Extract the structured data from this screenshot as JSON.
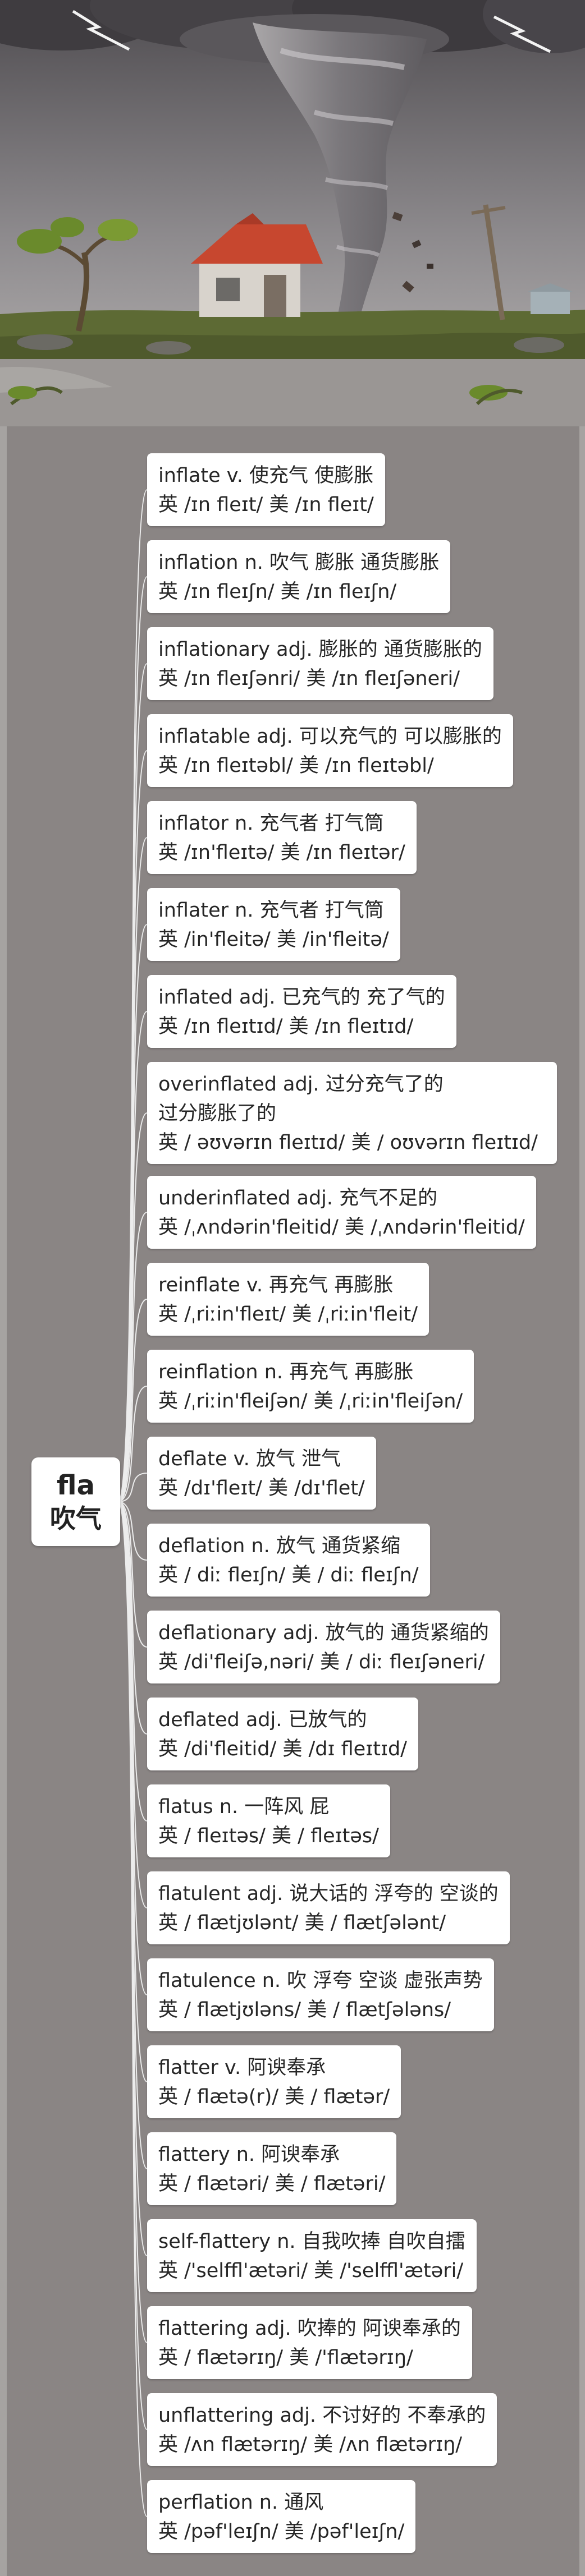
{
  "root": {
    "stem": "fla",
    "meaning": "吹气"
  },
  "words": [
    {
      "entry": "inflate v. 使充气 使膨胀",
      "pron": "英 /ɪn fleɪt/  美 /ɪn fleɪt/"
    },
    {
      "entry": "inflation n. 吹气 膨胀 通货膨胀",
      "pron": "英 /ɪn fleɪʃn/  美 /ɪn fleɪʃn/"
    },
    {
      "entry": "inflationary adj. 膨胀的 通货膨胀的",
      "pron": "英 /ɪn fleɪʃənri/  美 /ɪn fleɪʃəneri/"
    },
    {
      "entry": "inflatable adj. 可以充气的 可以膨胀的",
      "pron": "英 /ɪn fleɪtəbl/  美 /ɪn fleɪtəbl/"
    },
    {
      "entry": "inflator n. 充气者 打气筒",
      "pron": "英 /ɪn'fleɪtə/  美 /ɪn fleɪtər/"
    },
    {
      "entry": "inflater n. 充气者 打气筒",
      "pron": "英 /in'fleitə/ 美 /in'fleitə/"
    },
    {
      "entry": "inflated adj. 已充气的 充了气的",
      "pron": "英 /ɪn fleɪtɪd/  美 /ɪn fleɪtɪd/"
    },
    {
      "entry": "overinflated adj. 过分充气了的 过分膨胀了的",
      "pron": "英 / əʊvərɪn fleɪtɪd/  美 / oʊvərɪn fleɪtɪd/"
    },
    {
      "entry": "underinflated adj. 充气不足的",
      "pron": "英 /ˌʌndərin'fleitid/  美 /ˌʌndərin'fleitid/"
    },
    {
      "entry": "reinflate v. 再充气 再膨胀",
      "pron": "英 /ˌriːin'fleɪt/  美 /ˌriːin'fleit/"
    },
    {
      "entry": "reinflation n. 再充气 再膨胀",
      "pron": "英 /ˌriːin'fleiʃən/  美 /ˌriːin'fleiʃən/"
    },
    {
      "entry": "deflate v. 放气 泄气",
      "pron": "英 /dɪ'fleɪt/  美 /dɪ'flet/"
    },
    {
      "entry": "deflation n. 放气 通货紧缩",
      "pron": "英 / diː fleɪʃn/  美 / diː fleɪʃn/"
    },
    {
      "entry": "deflationary adj. 放气的 通货紧缩的",
      "pron": "英 /di'fleiʃə,nəri/  美 / diː fleɪʃəneri/"
    },
    {
      "entry": "deflated adj. 已放气的",
      "pron": "英 /di'fleitid/  美 /dɪ fleɪtɪd/"
    },
    {
      "entry": "flatus n. 一阵风 屁",
      "pron": "英 / fleɪtəs/  美 / fleɪtəs/"
    },
    {
      "entry": "flatulent adj. 说大话的 浮夸的 空谈的",
      "pron": "英 / flætjʊlənt/  美 / flætʃələnt/"
    },
    {
      "entry": "flatulence n. 吹 浮夸 空谈 虚张声势",
      "pron": "英 / flætjʊləns/  美 / flætʃələns/"
    },
    {
      "entry": "flatter v. 阿谀奉承",
      "pron": "英 / flætə(r)/  美 / flætər/"
    },
    {
      "entry": "flattery n. 阿谀奉承",
      "pron": "英 / flætəri/  美 / flætəri/"
    },
    {
      "entry": "self-flattery n. 自我吹捧 自吹自擂",
      "pron": "英 /'selffl'ætəri/  美 /'selffl'ætəri/"
    },
    {
      "entry": "flattering adj. 吹捧的 阿谀奉承的",
      "pron": "英 / flætərɪŋ/  美 /'flætərɪŋ/"
    },
    {
      "entry": "unflattering adj. 不讨好的 不奉承的",
      "pron": "英 /ʌn flætərɪŋ/  美 /ʌn flætərɪŋ/"
    },
    {
      "entry": "perflation n. 通风",
      "pron": "英 /pəf'leɪʃn/  美 /pəf'leɪʃn/"
    }
  ]
}
